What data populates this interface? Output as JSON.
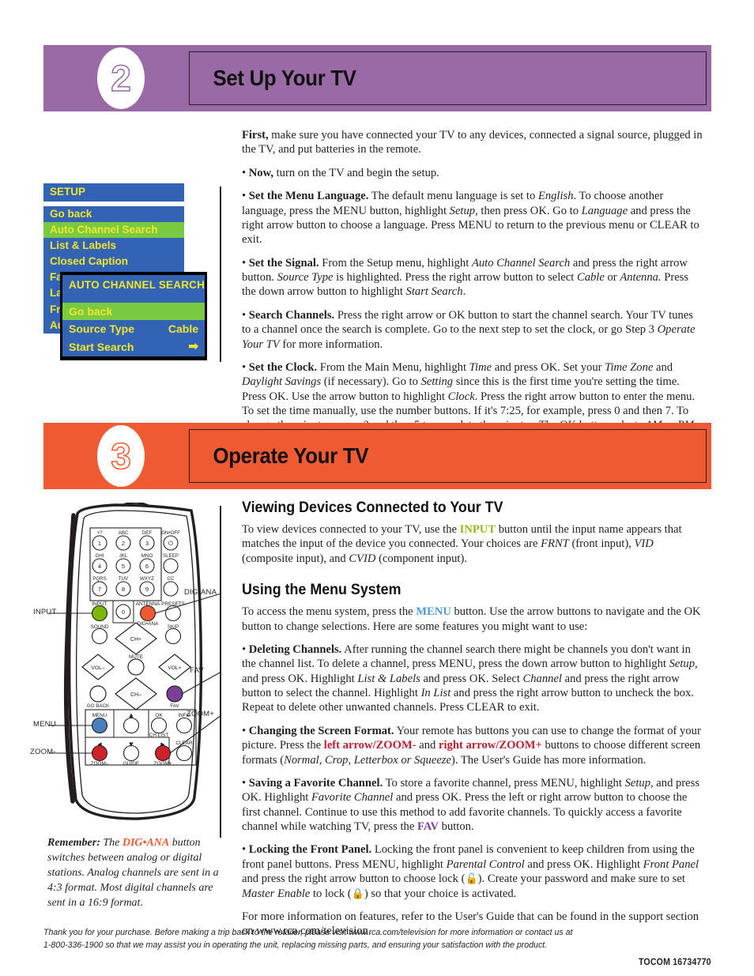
{
  "colors": {
    "step2_band": "#9a6aa6",
    "step3_band": "#f05a32",
    "osd_blue": "#3263b4",
    "osd_green": "#7ac943",
    "osd_yellow": "#f2e62a",
    "input_key": "#9cb51f",
    "menu_key": "#4f9ad7",
    "zoom_key": "#be1e2d",
    "fav_key": "#7b3f98",
    "digana_key": "#f05a32"
  },
  "step2": {
    "number": "2",
    "title": "Set Up Your TV",
    "paragraphs": [
      "First, make sure you have connected your TV to any devices, connected a signal source, plugged in the TV, and put batteries in the remote.",
      "• Now, turn on the TV and begin the setup.",
      "• Set the Menu Language. The default menu language is set to English. To choose another language, press the MENU button, highlight Setup, then press OK. Go to Language and press the right arrow button to choose a language. Press MENU to return to the previous menu or CLEAR to exit.",
      "• Set the Signal. From the Setup menu, highlight Auto Channel Search and press the right arrow button. Source Type is highlighted. Press the right arrow button to select Cable or Antenna. Press the down arrow button to highlight Start Search.",
      "• Search Channels. Press the right arrow or OK button to start the channel search. Your TV tunes to a channel once the search is complete. Go to the next step to set the clock, or go Step 3 Operate Your TV for more information.",
      "• Set the Clock. From the Main Menu, highlight Time and press OK. Set your Time Zone and Daylight Savings (if necessary). Go to Setting since this is the first time you're setting the time. Press OK. Use the arrow button to highlight Clock. Press the right arrow button to enter the menu. To set the time manually, use the number buttons. If it's 7:25, for example, press 0 and then 7. To change the minutes, press 2 and then 5 to complete the minutes. The OK button selects AM or PM. Press CLEAR to exit."
    ]
  },
  "osd_setup_menu": {
    "title": "SETUP",
    "items": [
      {
        "label": "Go back",
        "selected": false
      },
      {
        "label": "Auto Channel Search",
        "selected": true
      },
      {
        "label": "List & Labels",
        "selected": false
      },
      {
        "label": "Closed Caption",
        "selected": false
      },
      {
        "label": "Favorite Channel",
        "selected": false
      },
      {
        "label": "Language",
        "selected": false
      },
      {
        "label": "Front Panel",
        "selected": false
      },
      {
        "label": "Audio",
        "selected": false
      }
    ]
  },
  "osd_auto_search_menu": {
    "title": "AUTO CHANNEL SEARCH",
    "items": [
      {
        "label": "Go back",
        "value": "",
        "selected": true
      },
      {
        "label": "Source Type",
        "value": "Cable",
        "selected": false
      },
      {
        "label": "Start Search",
        "value": "➡",
        "selected": false
      }
    ]
  },
  "step3": {
    "number": "3",
    "title": "Operate Your TV",
    "heading1": "Viewing Devices Connected to Your TV",
    "heading2": "Using the Menu System",
    "p_viewing": "To view devices connected to your TV, use the INPUT button until the input name appears that matches the input of the device you connected. Your choices are FRNT (front input), VID (composite input), and CVID (component input).",
    "p_menu_intro": "To access the menu system, press the MENU button. Use the arrow buttons to navigate and the OK button to change selections. Here are some features you might want to use:",
    "p_deleting": "• Deleting Channels. After running the channel search there might be channels you don't want in the channel list. To delete a channel, press MENU, press the down arrow button to highlight Setup, and press OK. Highlight List & Labels and press OK. Select Channel and press the right arrow button to select the channel. Highlight In List and press the right arrow button to uncheck the box. Repeat to delete other unwanted channels. Press CLEAR to exit.",
    "p_format": "• Changing the Screen Format. Your remote has buttons you can use to change the format of your picture. Press the left arrow/ZOOM- and right arrow/ZOOM+ buttons to choose different screen formats (Normal, Crop, Letterbox or Squeeze). The User's Guide has more information.",
    "p_favorite": "• Saving a Favorite Channel. To store a favorite channel, press MENU, highlight Setup, and press OK. Highlight Favorite Channel and press OK. Press the left or right arrow button to choose the first channel. Continue to use this method to add favorite channels. To quickly access a favorite channel while watching TV, press the FAV button.",
    "p_locking": "• Locking the Front Panel. Locking the front panel is convenient to keep children from using the front panel buttons. Press MENU, highlight Parental Control and press OK. Highlight Front Panel and press the right arrow button to choose lock ( ). Create your password and make sure to set Master Enable to lock ( ) so that your choice is activated.",
    "p_more": "For more information on features, refer to the User's Guide that can be found in the support section on www.rca.com/television."
  },
  "remote": {
    "callouts_left": [
      "INPUT",
      "MENU",
      "ZOOM-"
    ],
    "callouts_right": [
      "DIG•ANA",
      "FAV",
      "ZOOM+"
    ],
    "keypad": [
      {
        "digit": "1",
        "above": "+?"
      },
      {
        "digit": "2",
        "above": "ABC"
      },
      {
        "digit": "3",
        "above": "DEF"
      },
      {
        "digit": "4",
        "above": "GHI"
      },
      {
        "digit": "5",
        "above": "JKL"
      },
      {
        "digit": "6",
        "above": "MNO"
      },
      {
        "digit": "7",
        "above": "PQRS"
      },
      {
        "digit": "8",
        "above": "TUV"
      },
      {
        "digit": "9",
        "above": "WXYZ"
      },
      {
        "digit": "0",
        "above": ""
      }
    ],
    "labels": {
      "on_off": "ON•OFF",
      "sleep": "SLEEP",
      "cc": "CC",
      "input": "INPUT",
      "antenna": "ANTENNA",
      "presets": "PRESETS",
      "digana": "DIG•ANA",
      "sound": "SOUND",
      "skip": "SKIP",
      "ch_plus": "CH+",
      "ch_minus": "CH–",
      "mute": "MUTE",
      "vol_minus": "VOL–",
      "vol_plus": "VOL+",
      "go_back": "GO BACK",
      "fav": "FAV",
      "menu": "MENU",
      "ok": "OK",
      "ch_list": "CH LIST",
      "info": "INFO",
      "clear": "CLEAR",
      "guide": "GUIDE",
      "zoom_minus": "ZOOM–",
      "zoom_plus": "ZOOM+"
    }
  },
  "remember_caption": {
    "lead": "Remember:",
    "text_before": " The ",
    "keyword": "DIG•ANA",
    "text_after": " button switches between analog or digital stations. Analog channels are sent in a 4:3 format. Most digital channels are sent in a 16:9 format."
  },
  "footer": {
    "line1": "Thank you for your purchase. Before making a trip back to the retailer, please visit www.rca.com/television for more information or contact us at",
    "line2": "1-800-336-1900 so that we may assist you in operating the unit, replacing missing parts, and ensuring your satisfaction with the product.",
    "tocom": "TOCOM 16734770"
  }
}
